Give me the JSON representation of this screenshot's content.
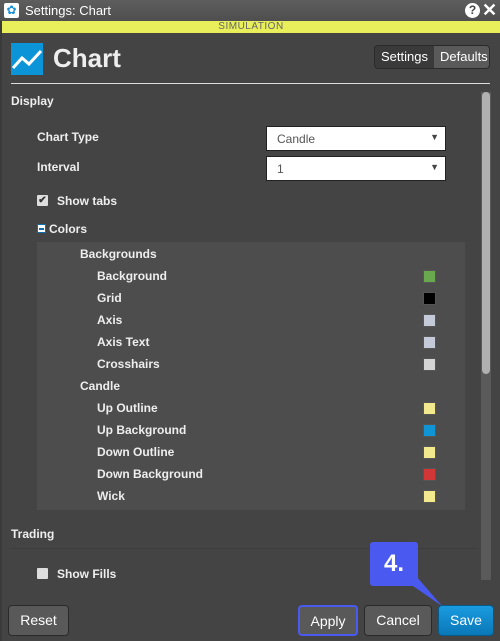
{
  "window": {
    "title": "Settings: Chart",
    "help_icon": "help-icon",
    "close_icon": "close-icon"
  },
  "banner": "SIMULATION",
  "header": {
    "title": "Chart",
    "tabs": [
      "Settings",
      "Defaults"
    ],
    "active_tab": "Defaults"
  },
  "display": {
    "heading": "Display",
    "chart_type_label": "Chart Type",
    "chart_type_value": "Candle",
    "interval_label": "Interval",
    "interval_value": "1",
    "show_tabs_label": "Show tabs",
    "show_tabs_checked": true,
    "colors_label": "Colors"
  },
  "colors": {
    "backgrounds_heading": "Backgrounds",
    "backgrounds": [
      {
        "name": "Background",
        "color": "#6aa84f"
      },
      {
        "name": "Grid",
        "color": "#000000"
      },
      {
        "name": "Axis",
        "color": "#c5cad8"
      },
      {
        "name": "Axis Text",
        "color": "#c5cad8"
      },
      {
        "name": "Crosshairs",
        "color": "#d4d4d4"
      }
    ],
    "candle_heading": "Candle",
    "candle": [
      {
        "name": "Up Outline",
        "color": "#f2e88e"
      },
      {
        "name": "Up Background",
        "color": "#0f95d6"
      },
      {
        "name": "Down Outline",
        "color": "#f2e88e"
      },
      {
        "name": "Down Background",
        "color": "#d33636"
      },
      {
        "name": "Wick",
        "color": "#f2e88e"
      }
    ]
  },
  "trading": {
    "heading": "Trading",
    "show_fills_label": "Show Fills",
    "show_fills_checked": false
  },
  "footer": {
    "reset": "Reset",
    "apply": "Apply",
    "cancel": "Cancel",
    "save": "Save"
  },
  "annotation": {
    "label": "4.",
    "color": "#4a5af0"
  }
}
